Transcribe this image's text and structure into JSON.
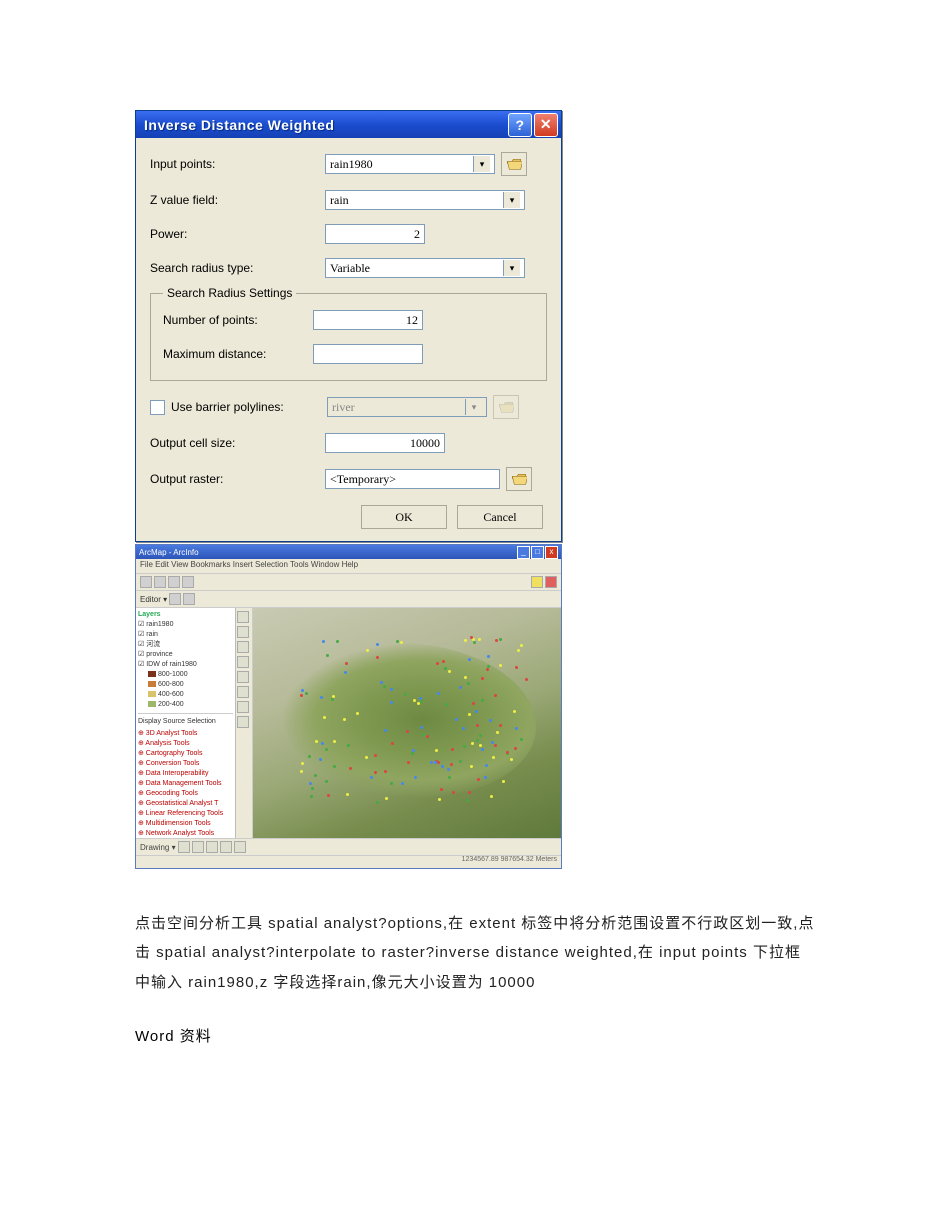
{
  "dialog": {
    "title": "Inverse Distance Weighted",
    "labels": {
      "input_points": "Input points:",
      "z_value_field": "Z value field:",
      "power": "Power:",
      "search_radius_type": "Search radius type:",
      "search_radius_settings": "Search Radius Settings",
      "number_of_points": "Number of points:",
      "maximum_distance": "Maximum distance:",
      "use_barrier_polylines": "Use barrier polylines:",
      "output_cell_size": "Output cell size:",
      "output_raster": "Output raster:"
    },
    "values": {
      "input_points": "rain1980",
      "z_value_field": "rain",
      "power": "2",
      "search_radius_type": "Variable",
      "number_of_points": "12",
      "maximum_distance": "",
      "barrier": "river",
      "output_cell_size": "10000",
      "output_raster": "<Temporary>"
    },
    "buttons": {
      "ok": "OK",
      "cancel": "Cancel"
    }
  },
  "gis": {
    "menu": "File  Edit  View  Bookmarks  Insert  Selection  Tools  Window  Help",
    "layers_header": "Layers",
    "layers": [
      "rain1980",
      "rain",
      "河流",
      "province",
      "IDW of rain1980"
    ],
    "legend": [
      {
        "c": "#7a321a",
        "t": "800-1000"
      },
      {
        "c": "#c97c3a",
        "t": "600-800"
      },
      {
        "c": "#d9c36a",
        "t": "400-600"
      },
      {
        "c": "#9fb76a",
        "t": "200-400"
      }
    ],
    "toolbox": [
      "3D Analyst Tools",
      "Analysis Tools",
      "Cartography Tools",
      "Conversion Tools",
      "Data Interoperability",
      "Data Management Tools",
      "Geocoding Tools",
      "Geostatistical Analyst T",
      "Linear Referencing Tools",
      "Multidimension Tools",
      "Network Analyst Tools"
    ]
  },
  "doc": {
    "p1": "点击空间分析工具 spatial analyst?options,在 extent 标签中将分析范围设置不行政区划一致,点击 spatial analyst?interpolate to raster?inverse distance weighted,在 input points 下拉框中输入 rain1980,z 字段选择rain,像元大小设置为 10000",
    "footer": "Word 资料"
  }
}
